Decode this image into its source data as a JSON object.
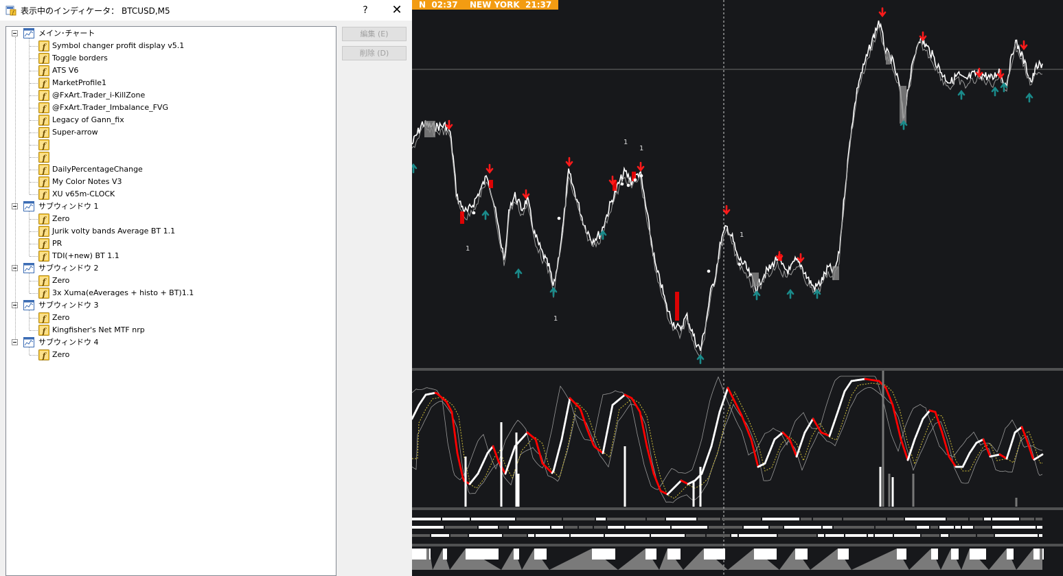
{
  "dialog": {
    "title": "表示中のインディケータ： BTCUSD,M5",
    "help": "?",
    "close": "✕",
    "buttons": {
      "edit": "編集 (E)",
      "delete": "削除 (D)"
    }
  },
  "tree": [
    {
      "type": "window",
      "label": "メイン･チャート"
    },
    {
      "type": "indicator",
      "label": "Symbol changer profit display v5.1"
    },
    {
      "type": "indicator",
      "label": "Toggle borders"
    },
    {
      "type": "indicator",
      "label": "ATS V6"
    },
    {
      "type": "indicator",
      "label": "MarketProfile1"
    },
    {
      "type": "indicator",
      "label": "@FxArt.Trader_i-KillZone"
    },
    {
      "type": "indicator",
      "label": "@FxArt.Trader_Imbalance_FVG"
    },
    {
      "type": "indicator",
      "label": "Legacy of Gann_fix"
    },
    {
      "type": "indicator",
      "label": "Super-arrow"
    },
    {
      "type": "indicator",
      "label": ""
    },
    {
      "type": "indicator",
      "label": ""
    },
    {
      "type": "indicator",
      "label": "DailyPercentageChange"
    },
    {
      "type": "indicator",
      "label": "My Color Notes V3"
    },
    {
      "type": "indicator",
      "label": "XU v65m-CLOCK"
    },
    {
      "type": "window",
      "label": "サブウィンドウ 1"
    },
    {
      "type": "indicator",
      "label": "Zero"
    },
    {
      "type": "indicator",
      "label": "Jurik volty bands Average BT 1.1"
    },
    {
      "type": "indicator",
      "label": "PR"
    },
    {
      "type": "indicator",
      "label": "TDI(+new) BT 1.1"
    },
    {
      "type": "window",
      "label": "サブウィンドウ 2"
    },
    {
      "type": "indicator",
      "label": "Zero"
    },
    {
      "type": "indicator",
      "label": "3x Xuma(eAverages + histo + BT)1.1"
    },
    {
      "type": "window",
      "label": "サブウィンドウ 3"
    },
    {
      "type": "indicator",
      "label": "Zero"
    },
    {
      "type": "indicator",
      "label": "Kingfisher's Net MTF nrp"
    },
    {
      "type": "window",
      "label": "サブウィンドウ 4"
    },
    {
      "type": "indicator",
      "label": "Zero"
    }
  ],
  "chart": {
    "clocks": [
      {
        "city": "N",
        "time": "02:37"
      },
      {
        "city": "NEW YORK",
        "time": "21:37"
      }
    ],
    "marker_label": "1",
    "colors": {
      "background": "#17181b",
      "price": "#ffffff",
      "down_arrow": "#ff1a1a",
      "up_arrow": "#1a8a8a",
      "signal": "#ff0000",
      "dotted": "#d4c23a",
      "clock": "#f39c12"
    }
  }
}
